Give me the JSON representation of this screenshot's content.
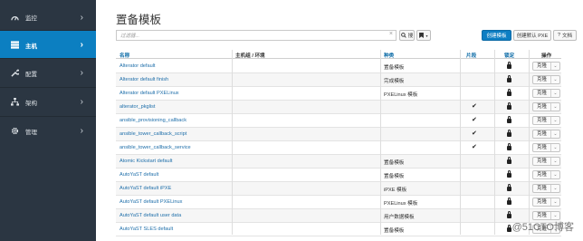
{
  "sidebar": {
    "items": [
      {
        "label": "监控",
        "icon": "dashboard-icon",
        "active": false
      },
      {
        "label": "主机",
        "icon": "server-icon",
        "active": true
      },
      {
        "label": "配置",
        "icon": "wrench-icon",
        "active": false
      },
      {
        "label": "架构",
        "icon": "sitemap-icon",
        "active": false
      },
      {
        "label": "管理",
        "icon": "gear-icon",
        "active": false
      }
    ]
  },
  "page": {
    "title": "置备模板"
  },
  "search": {
    "placeholder": "过滤器...",
    "search_label": "搜"
  },
  "toolbar": {
    "create_label": "创建模板",
    "create_pxe_label": "创建默认 PXE",
    "docs_label": "文档"
  },
  "table": {
    "headers": {
      "name": "名称",
      "host_group": "主机组 / 环境",
      "kind": "种类",
      "snippet": "片段",
      "locked": "锁定",
      "actions": "操作"
    },
    "clone_label": "克隆",
    "rows": [
      {
        "name": "Alterator default",
        "kind": "置备模板",
        "snippet": false,
        "locked": true
      },
      {
        "name": "Alterator default finish",
        "kind": "完成模板",
        "snippet": false,
        "locked": true
      },
      {
        "name": "Alterator default PXELinux",
        "kind": "PXELinux 模板",
        "snippet": false,
        "locked": true
      },
      {
        "name": "alterator_pkglist",
        "kind": "",
        "snippet": true,
        "locked": true
      },
      {
        "name": "ansible_provisioning_callback",
        "kind": "",
        "snippet": true,
        "locked": true
      },
      {
        "name": "ansible_tower_callback_script",
        "kind": "",
        "snippet": true,
        "locked": true
      },
      {
        "name": "ansible_tower_callback_service",
        "kind": "",
        "snippet": true,
        "locked": true
      },
      {
        "name": "Atomic Kickstart default",
        "kind": "置备模板",
        "snippet": false,
        "locked": true
      },
      {
        "name": "AutoYaST default",
        "kind": "置备模板",
        "snippet": false,
        "locked": true
      },
      {
        "name": "AutoYaST default iPXE",
        "kind": "iPXE 模板",
        "snippet": false,
        "locked": true
      },
      {
        "name": "AutoYaST default PXELinux",
        "kind": "PXELinux 模板",
        "snippet": false,
        "locked": true
      },
      {
        "name": "AutoYaST default user data",
        "kind": "用户数据模板",
        "snippet": false,
        "locked": true
      },
      {
        "name": "AutoYaST SLES default",
        "kind": "置备模板",
        "snippet": false,
        "locked": true
      }
    ]
  },
  "watermark": "@51CTO博客",
  "colors": {
    "sidebar_bg": "#2b3642",
    "accent": "#0c7fc1",
    "link": "#1f6faa"
  }
}
